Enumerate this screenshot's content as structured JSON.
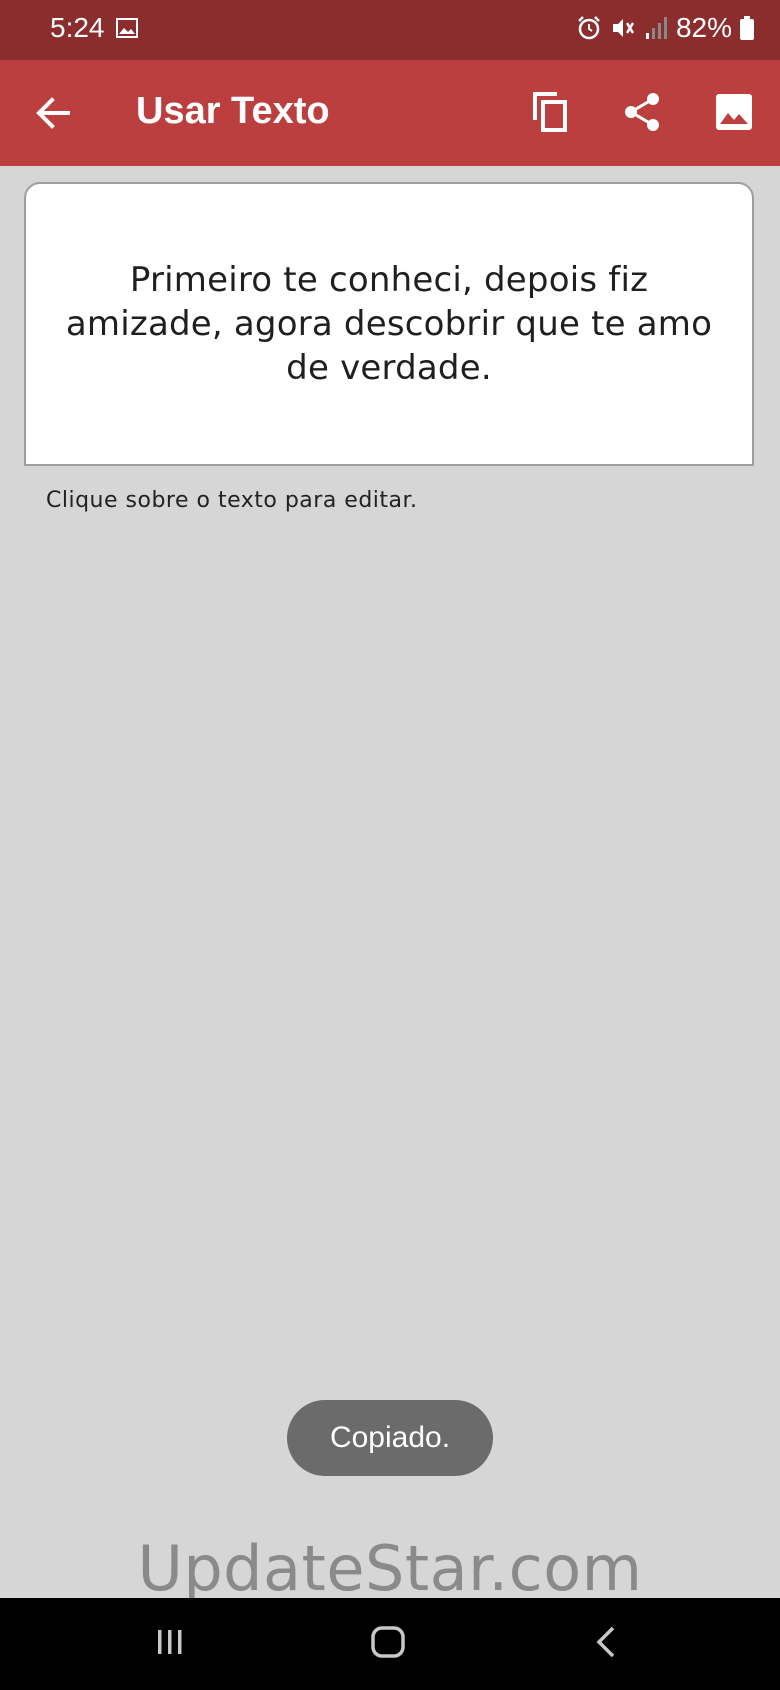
{
  "status_bar": {
    "time": "5:24",
    "battery": "82%",
    "icons": [
      "gallery-icon",
      "alarm-icon",
      "mute-vibrate-icon",
      "signal-icon",
      "battery-icon"
    ]
  },
  "app_bar": {
    "title": "Usar Texto",
    "icons": [
      "back-arrow-icon",
      "copy-icon",
      "share-icon",
      "image-icon"
    ]
  },
  "content": {
    "main_text": "Primeiro te conheci, depois fiz amizade, agora descobrir que te amo de verdade.",
    "hint": "Clique sobre o texto para editar."
  },
  "toast": {
    "message": "Copiado."
  },
  "watermark": "UpdateStar.com",
  "nav_bar": {
    "icons": [
      "recents-icon",
      "home-icon",
      "nav-back-icon"
    ]
  },
  "colors": {
    "status_bar": "#8b2c2d",
    "app_bar": "#bc3f40",
    "background": "#d6d6d6",
    "toast": "#6b6b6b"
  }
}
